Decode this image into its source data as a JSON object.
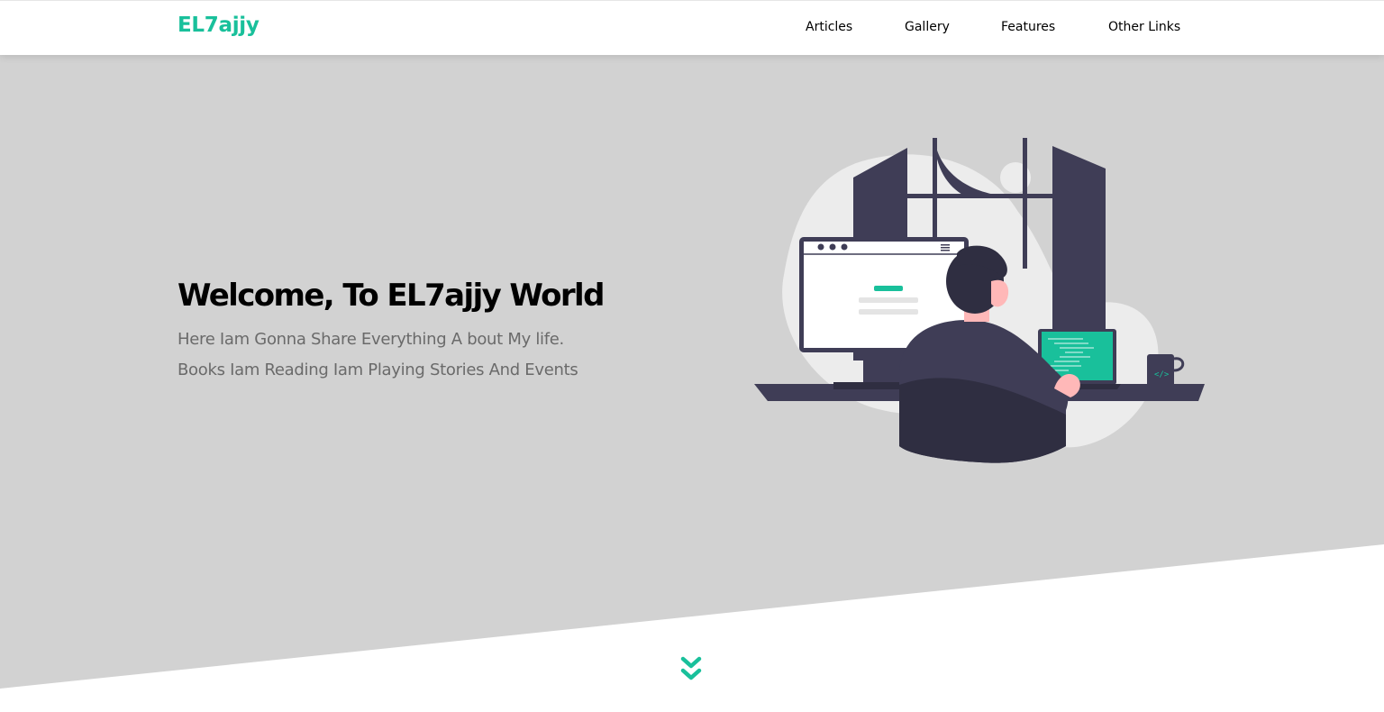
{
  "header": {
    "logo": "EL7ajjy",
    "nav": [
      {
        "label": "Articles"
      },
      {
        "label": "Gallery"
      },
      {
        "label": "Features"
      },
      {
        "label": "Other Links"
      }
    ]
  },
  "hero": {
    "title": "Welcome, To EL7ajjy World",
    "subtitle": "Here Iam Gonna Share Everything A bout My life. Books Iam Reading Iam Playing Stories And Events",
    "illustration": "person-at-computer-illustration"
  },
  "scroll": {
    "icon": "double-chevron-down-icon"
  },
  "colors": {
    "accent": "#19c09b",
    "hero_bg": "#d2d2d2",
    "dark": "#3f3d56",
    "text_muted": "#6a6a6a"
  }
}
